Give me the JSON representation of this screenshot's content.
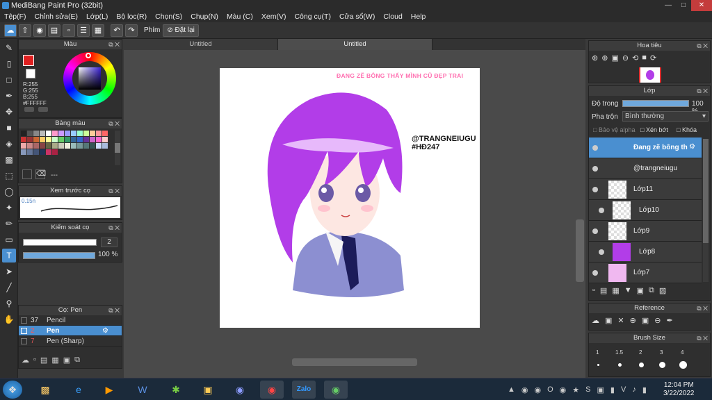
{
  "window": {
    "title": "MediBang Paint Pro (32bit)"
  },
  "menu": [
    "Tệp(F)",
    "Chỉnh sửa(E)",
    "Lớp(L)",
    "Bộ lọc(R)",
    "Chọn(S)",
    "Chụp(N)",
    "Màu (C)",
    "Xem(V)",
    "Công cụ(T)",
    "Cửa sổ(W)",
    "Cloud",
    "Help"
  ],
  "toolbar": {
    "snap_label": "Phím",
    "reset_label": "Đặt lại"
  },
  "color_panel": {
    "title": "Màu",
    "rgb_r": "R:255",
    "rgb_g": "G:255",
    "rgb_b": "B:255",
    "hex": "#FFFFFF"
  },
  "palette_panel": {
    "title": "Bảng màu",
    "footer": "---"
  },
  "brush_preview": {
    "title": "Xem trước cọ",
    "size": "0.15n"
  },
  "brush_control": {
    "title": "Kiểm soát cọ",
    "size_value": "2",
    "opacity_value": "100 %",
    "size_fraction": 1.0,
    "opacity_fraction": 1.0
  },
  "brush_panel": {
    "title": "Cọ: Pen",
    "items": [
      {
        "num": "37",
        "name": "Pencil",
        "color": "#333333"
      },
      {
        "num": "2",
        "name": "Pen",
        "color": "#cc3333"
      },
      {
        "num": "7",
        "name": "Pen (Sharp)",
        "color": "#333333"
      }
    ]
  },
  "tabs": [
    "Untitled",
    "Untitled"
  ],
  "canvas_text": {
    "top_caption": "ĐANG ZẼ BÔNG THẤY MÌNH CŨ ĐẸP TRAI",
    "handle": "@TRANGNEIUGU",
    "tag": "#HĐ247"
  },
  "navigator": {
    "title": "Hoa tiêu"
  },
  "layer_panel": {
    "title": "Lớp",
    "opacity_label": "Độ trong",
    "opacity_value": "100 %",
    "opacity_fraction": 1.0,
    "blend_label": "Pha trộn",
    "blend_value": "Bình thường",
    "protect_alpha": "Bảo vệ alpha",
    "clip": "Xén bớt",
    "lock": "Khóa",
    "layers": [
      {
        "name": "Đang zẽ bông th",
        "selected": true
      },
      {
        "name": "@trangneiugu",
        "selected": false
      },
      {
        "name": "Lớp11",
        "selected": false
      },
      {
        "name": "Lớp10",
        "selected": false
      },
      {
        "name": "Lớp9",
        "selected": false
      },
      {
        "name": "Lớp8",
        "selected": false
      },
      {
        "name": "Lớp7",
        "selected": false
      }
    ]
  },
  "reference_panel": {
    "title": "Reference"
  },
  "brush_size_panel": {
    "title": "Brush Size",
    "sizes": [
      "1",
      "1.5",
      "2",
      "3",
      "4"
    ]
  },
  "taskbar": {
    "time": "12:04 PM",
    "date": "3/22/2022",
    "ime": "V"
  },
  "colors": {
    "accent": "#4a8fd0",
    "panel_bg": "#2f2f2f",
    "hair": "#b23de8",
    "uniform": "#8c8fd1"
  }
}
